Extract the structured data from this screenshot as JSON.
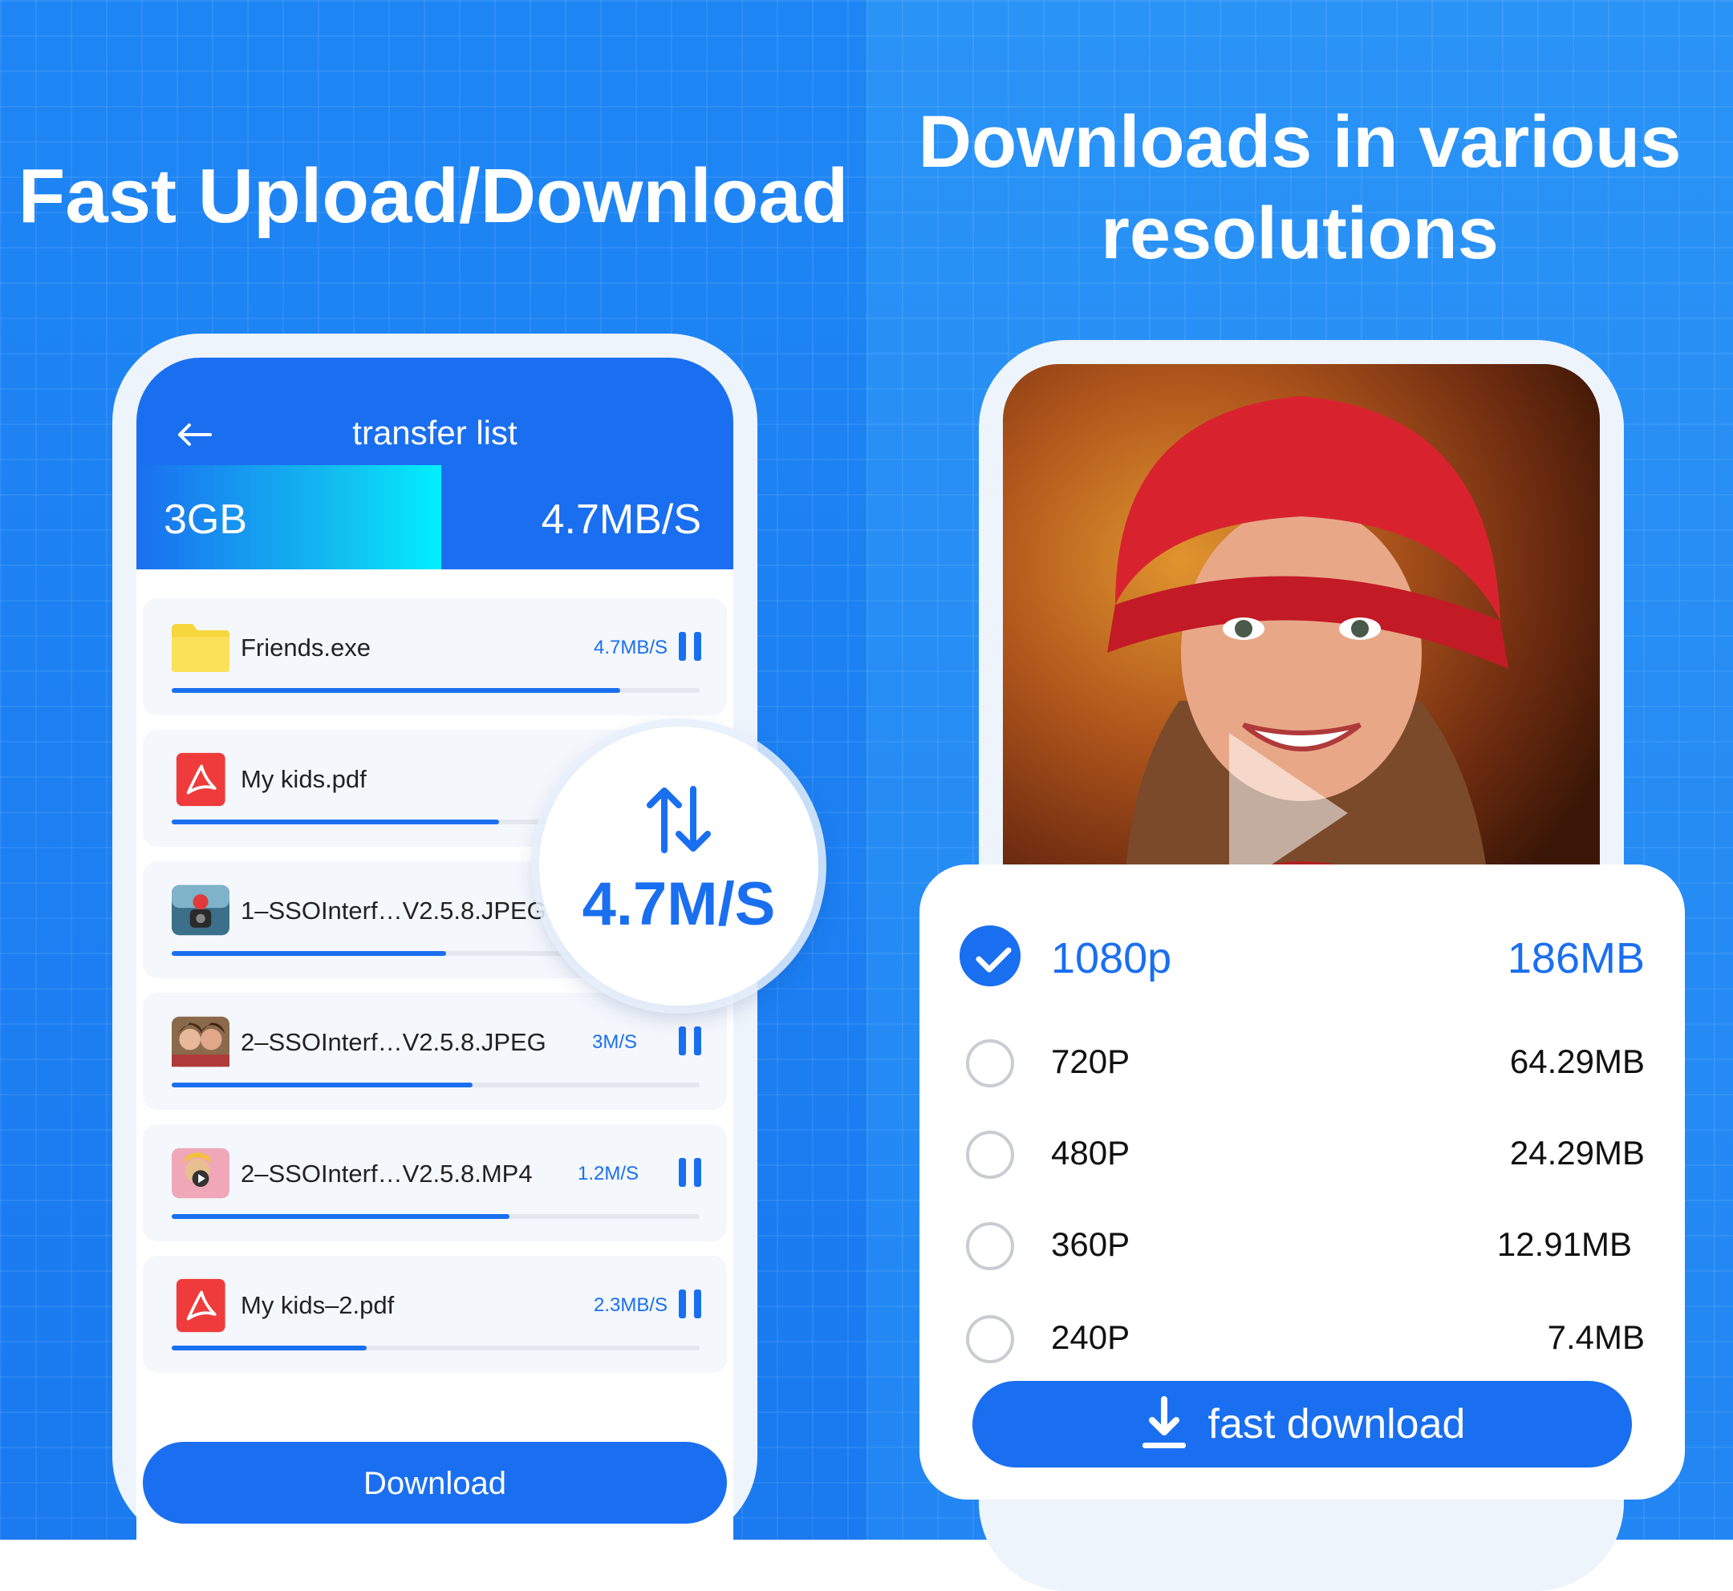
{
  "left": {
    "headline": "Fast Upload/Download",
    "app_title": "transfer list",
    "total_size": "3GB",
    "total_speed": "4.7MB/S",
    "files": [
      {
        "name": "Friends.exe",
        "speed": "4.7MB/S",
        "icon": "folder-icon",
        "progress": 0.85
      },
      {
        "name": "My kids.pdf",
        "speed": "",
        "icon": "pdf-icon",
        "progress": 0.62
      },
      {
        "name": "1–SSOInterf…V2.5.8.JPEG",
        "speed": "",
        "icon": "photo-thumbnail",
        "progress": 0.52
      },
      {
        "name": "2–SSOInterf…V2.5.8.JPEG",
        "speed": "3M/S",
        "icon": "photo-thumbnail",
        "progress": 0.57
      },
      {
        "name": "2–SSOInterf…V2.5.8.MP4",
        "speed": "1.2M/S",
        "icon": "video-thumbnail",
        "progress": 0.64
      },
      {
        "name": "My kids–2.pdf",
        "speed": "2.3MB/S",
        "icon": "pdf-icon",
        "progress": 0.37
      }
    ],
    "download_label": "Download",
    "badge_speed": "4.7M/S"
  },
  "right": {
    "headline_line1": "Downloads in various",
    "headline_line2": "resolutions",
    "resolutions": [
      {
        "label": "1080p",
        "size": "186MB",
        "selected": true
      },
      {
        "label": "720P",
        "size": "64.29MB",
        "selected": false
      },
      {
        "label": "480P",
        "size": "24.29MB",
        "selected": false
      },
      {
        "label": "360P",
        "size": "12.91MB",
        "selected": false
      },
      {
        "label": "240P",
        "size": "7.4MB",
        "selected": false
      }
    ],
    "fast_download_label": "fast download"
  },
  "colors": {
    "accent": "#1a6ff0",
    "background": "#1e86f4",
    "cyan": "#00f0ff"
  }
}
